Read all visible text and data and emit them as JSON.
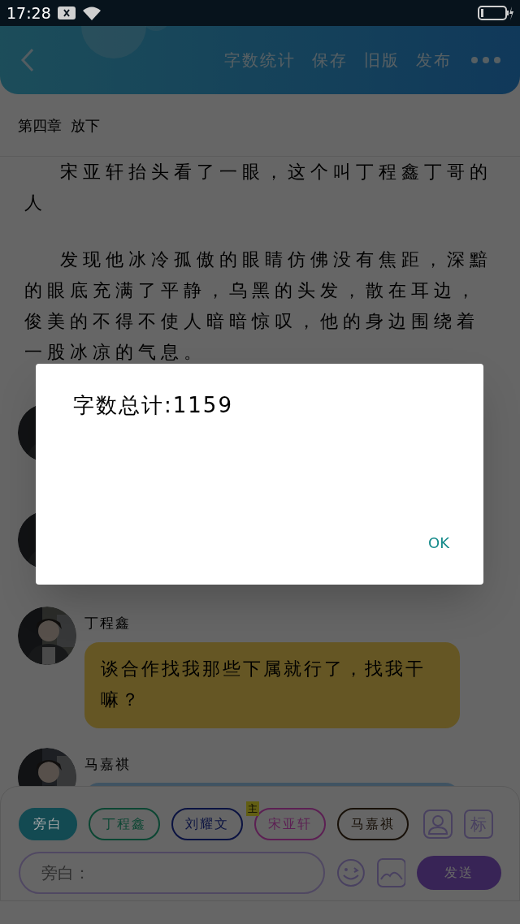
{
  "status_bar": {
    "time": "17:28"
  },
  "header": {
    "actions": [
      "字数统计",
      "保存",
      "旧版",
      "发布"
    ]
  },
  "chapter_title": "第四章  放下",
  "paragraphs": [
    "宋亚轩抬头看了一眼，这个叫丁程鑫丁哥的人",
    "发现他冰冷孤傲的眼睛仿佛没有焦距，深黯的眼底充满了平静，乌黑的头发，散在耳边，俊美的不得不使人暗暗惊叹，他的身边围绕着一股冰凉的气息。"
  ],
  "messages": [
    {
      "kind": "covered"
    },
    {
      "kind": "covered"
    },
    {
      "kind": "visible",
      "name": "丁程鑫",
      "text": "谈合作找我那些下属就行了，找我干嘛？",
      "color": "#655624"
    },
    {
      "kind": "visible",
      "name": "马嘉祺",
      "color": "#405362"
    }
  ],
  "characters": [
    {
      "name": "旁白",
      "selected": true,
      "color": "#134a52"
    },
    {
      "name": "丁程鑫",
      "selected": false,
      "color": "#0c4633"
    },
    {
      "name": "刘耀文",
      "selected": false,
      "color": "#0b1341"
    },
    {
      "name": "宋亚轩",
      "selected": false,
      "color": "#5c2053",
      "badge": "主"
    },
    {
      "name": "马嘉祺",
      "selected": false,
      "color": "#181109"
    }
  ],
  "tag_button": "标",
  "input": {
    "placeholder": "旁白："
  },
  "send_button": "发送",
  "dialog": {
    "message": "字数总计:1159",
    "button": "OK"
  }
}
